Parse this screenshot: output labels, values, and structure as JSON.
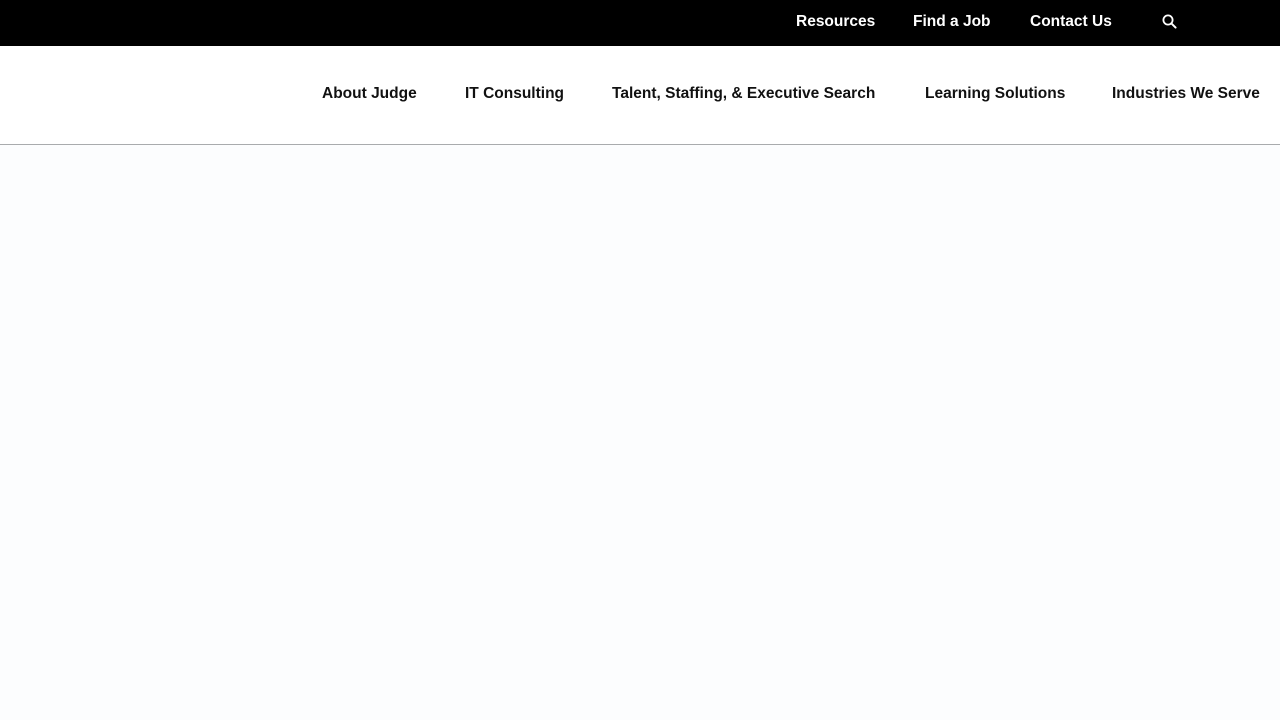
{
  "utility_nav": {
    "items": [
      {
        "label": "Resources"
      },
      {
        "label": "Find a Job"
      },
      {
        "label": "Contact Us"
      }
    ],
    "search_icon": "search-icon"
  },
  "main_nav": {
    "items": [
      {
        "label": "About Judge"
      },
      {
        "label": "IT Consulting"
      },
      {
        "label": "Talent, Staffing, & Executive Search"
      },
      {
        "label": "Learning Solutions"
      },
      {
        "label": "Industries We Serve"
      }
    ]
  },
  "colors": {
    "utility_bar_bg": "#000000",
    "utility_text": "#ffffff",
    "nav_bg": "#ffffff",
    "nav_text": "#111111",
    "divider": "#a9abad",
    "page_bg": "#fcfdfe"
  }
}
